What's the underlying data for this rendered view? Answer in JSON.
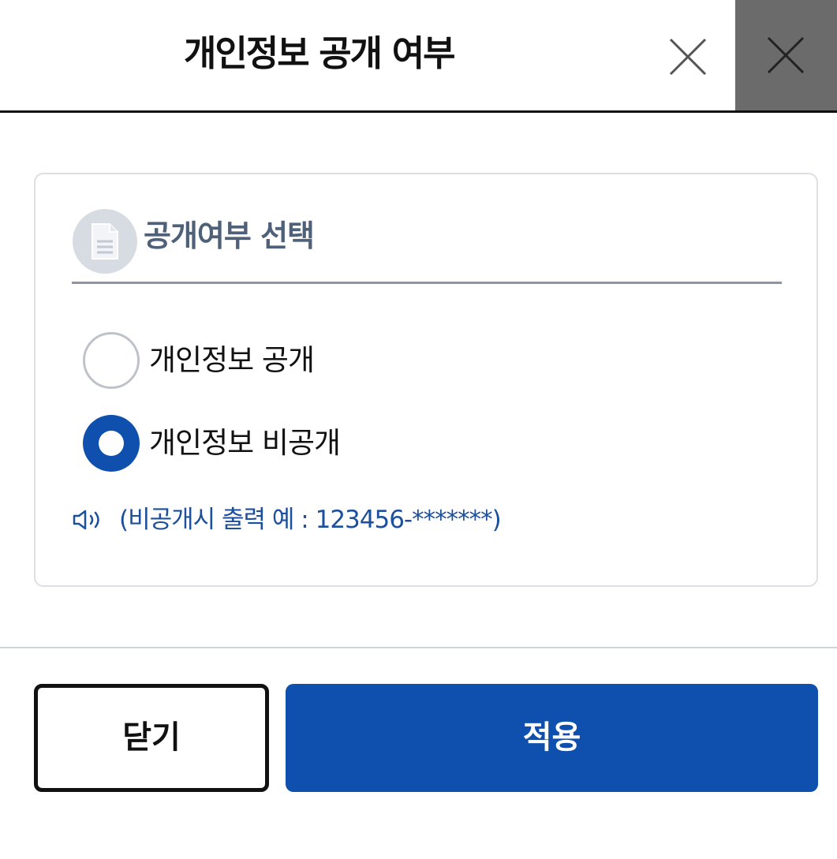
{
  "header": {
    "title": "개인정보 공개 여부",
    "close_icon": "close-icon",
    "close_dark_icon": "close-icon"
  },
  "section": {
    "icon": "document-icon",
    "title": "공개여부 선택"
  },
  "options": [
    {
      "label": "개인정보 공개",
      "selected": false
    },
    {
      "label": "개인정보 비공개",
      "selected": true
    }
  ],
  "note": {
    "icon": "speaker-icon",
    "text": "(비공개시 출력 예 : 123456-*******)"
  },
  "footer": {
    "close_label": "닫기",
    "apply_label": "적용"
  },
  "colors": {
    "primary": "#0f4fae",
    "note_text": "#1c4f9c",
    "section_title": "#4e6178",
    "dark_close_bg": "#6b6b6b"
  }
}
